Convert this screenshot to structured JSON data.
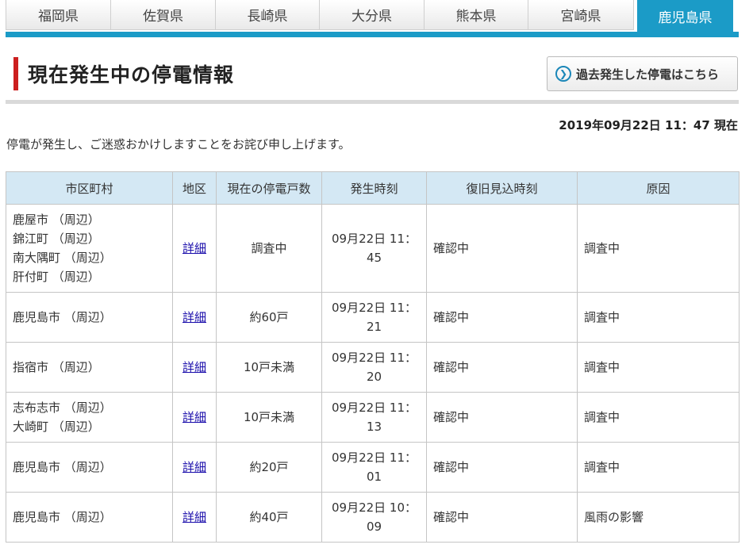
{
  "tabs": [
    {
      "label": "福岡県"
    },
    {
      "label": "佐賀県"
    },
    {
      "label": "長崎県"
    },
    {
      "label": "大分県"
    },
    {
      "label": "熊本県"
    },
    {
      "label": "宮崎県"
    },
    {
      "label": "鹿児島県"
    }
  ],
  "header": {
    "title": "現在発生中の停電情報",
    "past_button_label": "過去発生した停電はこちら",
    "timestamp": "2019年09月22日 11：47 現在",
    "apology": "停電が発生し、ご迷惑おかけしますことをお詫び申し上げます。"
  },
  "table": {
    "columns": [
      "市区町村",
      "地区",
      "現在の停電戸数",
      "発生時刻",
      "復旧見込時刻",
      "原因"
    ],
    "rows": [
      {
        "areas": [
          "鹿屋市 （周辺）",
          "錦江町 （周辺）",
          "南大隅町 （周辺）",
          "肝付町 （周辺）"
        ],
        "detail": "詳細",
        "households": "調査中",
        "occurred": "09月22日 11：45",
        "restore": "確認中",
        "cause": "調査中"
      },
      {
        "areas": [
          "鹿児島市 （周辺）"
        ],
        "detail": "詳細",
        "households": "約60戸",
        "occurred": "09月22日 11：21",
        "restore": "確認中",
        "cause": "調査中"
      },
      {
        "areas": [
          "指宿市 （周辺）"
        ],
        "detail": "詳細",
        "households": "10戸未満",
        "occurred": "09月22日 11：20",
        "restore": "確認中",
        "cause": "調査中"
      },
      {
        "areas": [
          "志布志市 （周辺）",
          "大崎町 （周辺）"
        ],
        "detail": "詳細",
        "households": "10戸未満",
        "occurred": "09月22日 11：13",
        "restore": "確認中",
        "cause": "調査中"
      },
      {
        "areas": [
          "鹿児島市 （周辺）"
        ],
        "detail": "詳細",
        "households": "約20戸",
        "occurred": "09月22日 11：01",
        "restore": "確認中",
        "cause": "調査中"
      },
      {
        "areas": [
          "鹿児島市 （周辺）"
        ],
        "detail": "詳細",
        "households": "約40戸",
        "occurred": "09月22日 10：09",
        "restore": "確認中",
        "cause": "風雨の影響"
      }
    ]
  },
  "colors": {
    "accent_blue": "#1b9bc7",
    "title_red": "#cc1f1f",
    "header_bg": "#d4e8f4"
  }
}
